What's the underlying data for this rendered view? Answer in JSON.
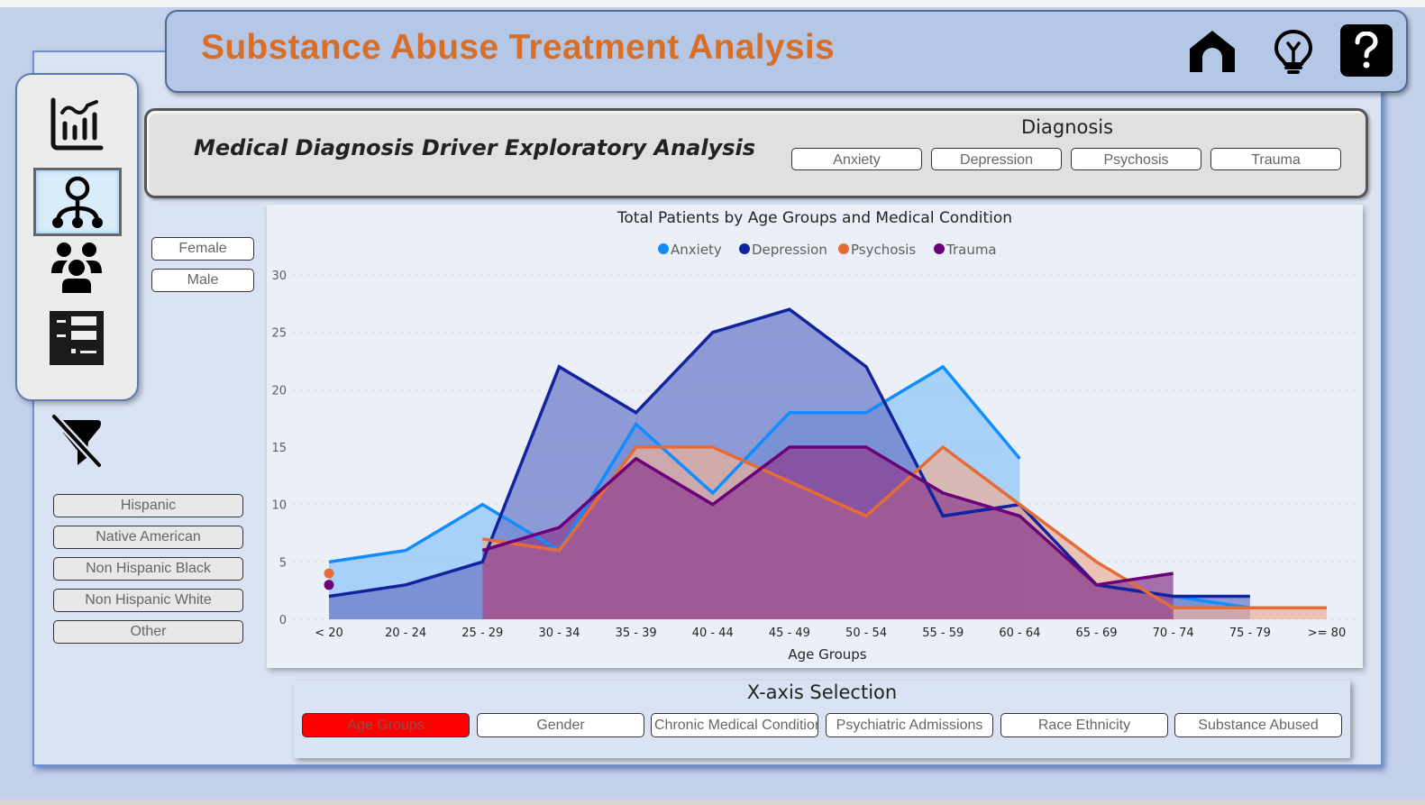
{
  "header": {
    "title": "Substance Abuse Treatment Analysis",
    "icons": [
      "home-icon",
      "lightbulb-icon",
      "help-icon"
    ]
  },
  "nav": {
    "items": [
      {
        "name": "chart-page",
        "icon": "chart-icon",
        "selected": false
      },
      {
        "name": "drivers-page",
        "icon": "hierarchy-icon",
        "selected": true
      },
      {
        "name": "demographics-page",
        "icon": "people-icon",
        "selected": false
      },
      {
        "name": "details-page",
        "icon": "list-icon",
        "selected": false
      }
    ],
    "clear_filter_icon": "clear-filter-icon"
  },
  "page": {
    "subtitle": "Medical Diagnosis Driver Exploratory Analysis"
  },
  "diagnosis": {
    "title": "Diagnosis",
    "options": [
      "Anxiety",
      "Depression",
      "Psychosis",
      "Trauma"
    ]
  },
  "gender": {
    "options": [
      "Female",
      "Male"
    ]
  },
  "race": {
    "options": [
      "Hispanic",
      "Native American",
      "Non Hispanic Black",
      "Non Hispanic White",
      "Other"
    ]
  },
  "xaxis_selection": {
    "title": "X-axis Selection",
    "options": [
      "Age Groups",
      "Gender",
      "Chronic Medical Conditions",
      "Psychiatric Admissions",
      "Race Ethnicity",
      "Substance Abused"
    ],
    "selected": "Age Groups",
    "active_color": "#ff0000"
  },
  "chart_data": {
    "type": "area",
    "title": "Total Patients by Age Groups and Medical Condition",
    "xlabel": "Age Groups",
    "ylabel": "",
    "ylim": [
      0,
      30
    ],
    "yticks": [
      0,
      5,
      10,
      15,
      20,
      25,
      30
    ],
    "grid": true,
    "legend_position": "top-center",
    "categories": [
      "< 20",
      "20 - 24",
      "25 - 29",
      "30 - 34",
      "35 - 39",
      "40 - 44",
      "45 - 49",
      "50 - 54",
      "55 - 59",
      "60 - 64",
      "65 - 69",
      "70 - 74",
      "75 - 79",
      ">= 80"
    ],
    "series": [
      {
        "name": "Anxiety",
        "color": "#118dff",
        "fill": "#8ec5fa",
        "values": [
          5,
          6,
          10,
          6,
          17,
          11,
          18,
          18,
          22,
          14,
          null,
          2,
          1,
          null
        ]
      },
      {
        "name": "Depression",
        "color": "#12239e",
        "fill": "#6b78c8",
        "values": [
          2,
          3,
          5,
          22,
          18,
          25,
          27,
          22,
          9,
          10,
          3,
          2,
          2,
          null
        ]
      },
      {
        "name": "Psychosis",
        "color": "#e66c37",
        "fill": "#ebb09a",
        "values": [
          4,
          null,
          7,
          6,
          15,
          15,
          12,
          9,
          15,
          10,
          5,
          1,
          1,
          1
        ]
      },
      {
        "name": "Trauma",
        "color": "#6b007b",
        "fill": "#8a3d8f",
        "values": [
          3,
          null,
          6,
          8,
          14,
          10,
          15,
          15,
          11,
          9,
          3,
          4,
          null,
          null
        ]
      }
    ]
  }
}
